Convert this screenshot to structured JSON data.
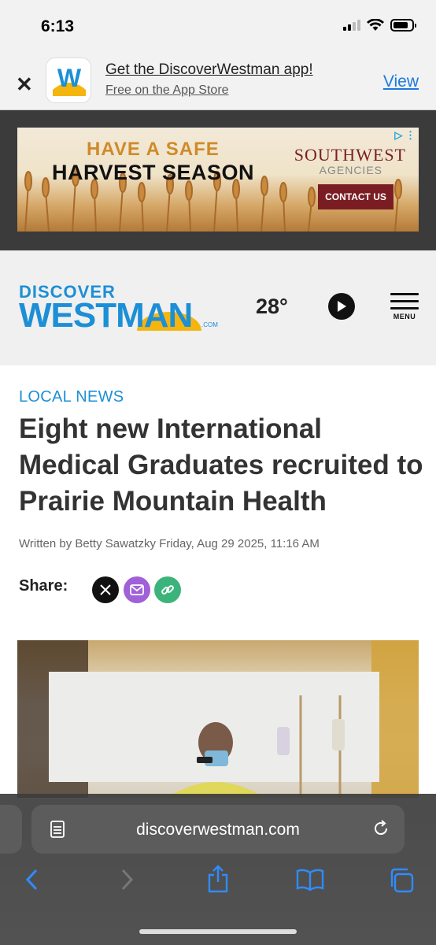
{
  "status_bar": {
    "time": "6:13"
  },
  "app_banner": {
    "title": "Get the DiscoverWestman app!",
    "subtitle": "Free on the App Store",
    "view_label": "View",
    "icon_letter": "W"
  },
  "ad": {
    "headline_1": "HAVE A SAFE",
    "headline_2": "HARVEST SEASON",
    "brand": "SOUTHWEST",
    "brand_sub": "AGENCIES",
    "cta": "CONTACT US"
  },
  "header": {
    "logo_top": "DISCOVER",
    "logo_main": "WESTMAN",
    "logo_suffix": ".COM",
    "temperature": "28°",
    "menu_label": "MENU"
  },
  "article": {
    "category": "LOCAL NEWS",
    "headline": "Eight new International Medical Graduates recruited to Prairie Mountain Health",
    "byline": "Written by Betty Sawatzky Friday, Aug 29 2025, 11:16 AM",
    "share_label": "Share:"
  },
  "safari": {
    "url": "discoverwestman.com"
  },
  "colors": {
    "brand_blue": "#1c8fd6",
    "ad_cta": "#7a1d22",
    "link_blue": "#1a7ae0"
  },
  "icons": [
    "close-icon",
    "signal-icon",
    "wifi-icon",
    "battery-icon",
    "play-icon",
    "menu-icon",
    "x-logo-icon",
    "mail-icon",
    "link-icon",
    "reader-icon",
    "reload-icon",
    "back-icon",
    "forward-icon",
    "share-icon",
    "bookmarks-icon",
    "tabs-icon"
  ]
}
